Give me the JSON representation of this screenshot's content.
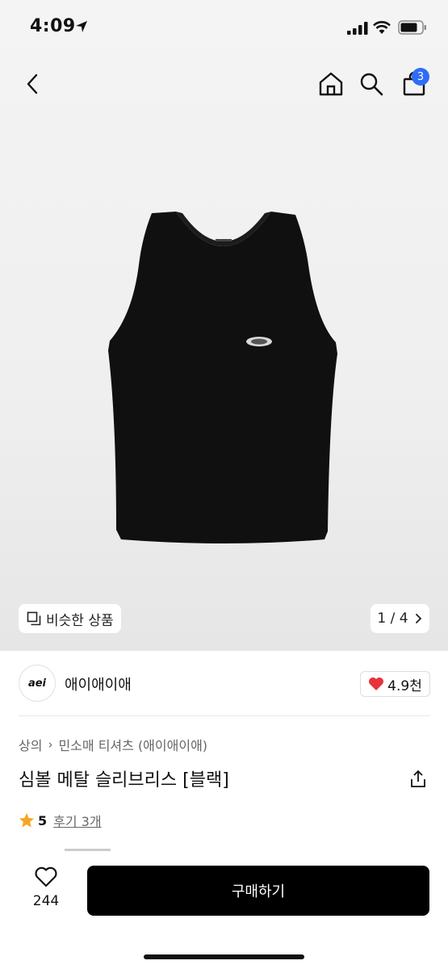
{
  "status_bar": {
    "time": "4:09"
  },
  "nav": {
    "cart_count": "3"
  },
  "image_chips": {
    "similar_label": "비슷한 상품",
    "page_indicator": "1 / 4"
  },
  "seller": {
    "logo_text": "aei",
    "name": "애이애이애",
    "likes": "4.9천"
  },
  "product": {
    "breadcrumb": [
      "상의",
      "민소매 티셔츠 (애이애이애)"
    ],
    "title": "심볼 메탈 슬리브리스 [블랙]",
    "rating": "5",
    "review_label": "후기 3개"
  },
  "bottom": {
    "wish_count": "244",
    "buy_label": "구매하기"
  },
  "colors": {
    "badge": "#2f6df6",
    "heart": "#e8333b",
    "star": "#f5a623",
    "buy_button": "#000000"
  }
}
